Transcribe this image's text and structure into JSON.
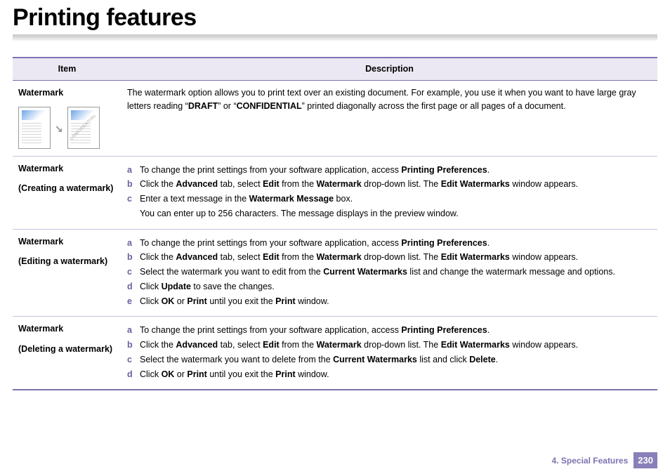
{
  "title": "Printing features",
  "table": {
    "headers": {
      "item": "Item",
      "description": "Description"
    },
    "rows": [
      {
        "item_title": "Watermark",
        "desc_parts": {
          "p1": "The watermark option allows you to print text over an existing document. For example, you use it when you want to have large gray letters reading “",
          "b1": "DRAFT",
          "p2": "” or “",
          "b2": "CONFIDENTIAL",
          "p3": "” printed diagonally across the first page or all pages of a document."
        },
        "has_thumbs": true
      },
      {
        "item_title": "Watermark",
        "item_sub": "(Creating a watermark)",
        "steps": [
          {
            "k": "a",
            "segs": [
              "To change the print settings from your software application, access ",
              "Printing Preferences",
              "."
            ]
          },
          {
            "k": "b",
            "segs": [
              "Click the ",
              "Advanced",
              " tab, select ",
              "Edit",
              " from the ",
              "Watermark",
              " drop-down list. The ",
              "Edit Watermarks",
              " window appears."
            ]
          },
          {
            "k": "c",
            "segs": [
              "Enter a text message in the ",
              "Watermark Message",
              " box."
            ],
            "extra": "You can enter up to 256 characters. The message displays in the preview window."
          }
        ]
      },
      {
        "item_title": "Watermark",
        "item_sub": "(Editing a watermark)",
        "steps": [
          {
            "k": "a",
            "segs": [
              "To change the print settings from your software application, access ",
              "Printing Preferences",
              "."
            ]
          },
          {
            "k": "b",
            "segs": [
              "Click the ",
              "Advanced",
              " tab, select ",
              "Edit",
              " from the ",
              "Watermark",
              " drop-down list. The ",
              "Edit Watermarks",
              " window appears."
            ]
          },
          {
            "k": "c",
            "segs": [
              "Select the watermark you want to edit from the ",
              "Current Watermarks",
              " list and change the watermark message and options."
            ]
          },
          {
            "k": "d",
            "segs": [
              "Click ",
              "Update",
              " to save the changes."
            ]
          },
          {
            "k": "e",
            "segs": [
              "Click ",
              "OK",
              " or ",
              "Print",
              " until you exit the ",
              "Print",
              " window."
            ]
          }
        ]
      },
      {
        "item_title": "Watermark",
        "item_sub": "(Deleting a watermark)",
        "steps": [
          {
            "k": "a",
            "segs": [
              "To change the print settings from your software application, access ",
              "Printing Preferences",
              "."
            ]
          },
          {
            "k": "b",
            "segs": [
              "Click the ",
              "Advanced",
              " tab, select ",
              "Edit",
              " from the ",
              "Watermark",
              " drop-down list. The ",
              "Edit Watermarks",
              " window appears."
            ]
          },
          {
            "k": "c",
            "segs": [
              "Select the watermark you want to delete from the ",
              "Current Watermarks",
              " list and click ",
              "Delete",
              "."
            ]
          },
          {
            "k": "d",
            "segs": [
              "Click ",
              "OK",
              " or ",
              "Print",
              " until you exit the ",
              "Print",
              " window."
            ]
          }
        ]
      }
    ]
  },
  "footer": {
    "chapter": "4.  Special Features",
    "page": "230"
  }
}
